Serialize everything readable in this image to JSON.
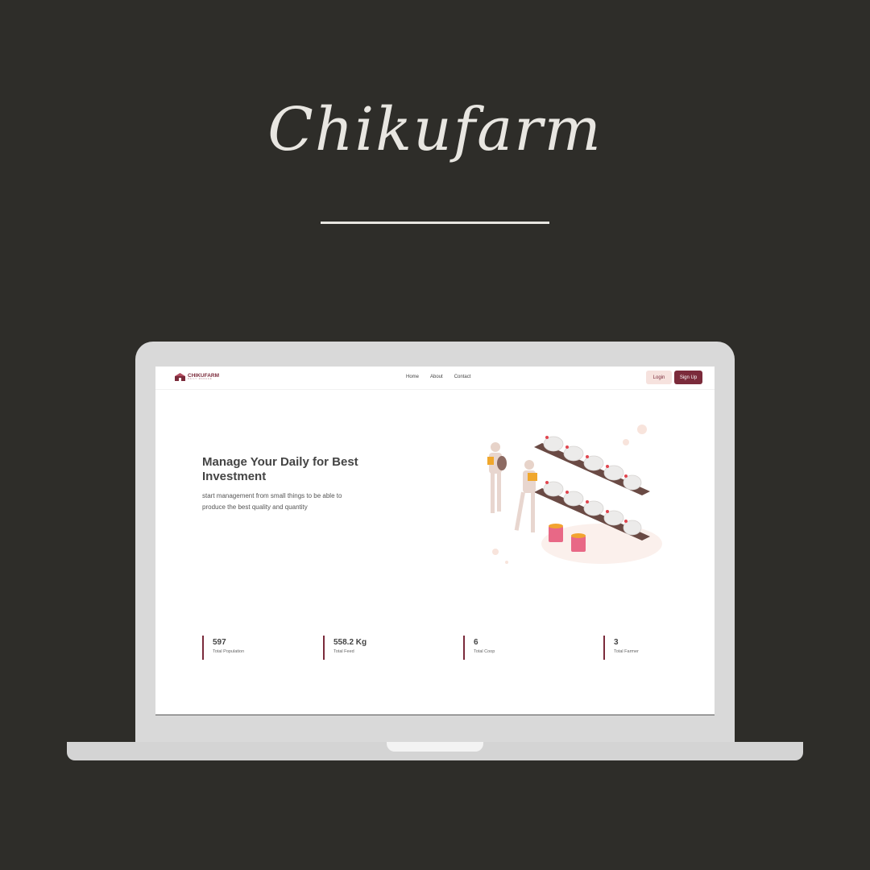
{
  "brand": {
    "title": "Chikufarm"
  },
  "app": {
    "logo": {
      "name": "CHIKUFARM",
      "tagline": "DAILY MANAGE"
    },
    "nav": {
      "links": [
        "Home",
        "About",
        "Contact"
      ]
    },
    "buttons": {
      "login": "Login",
      "signup": "Sign Up"
    },
    "hero": {
      "heading": "Manage Your Daily for Best Investment",
      "subtitle": "start management from small things to be able to produce the best quality and quantity"
    },
    "stats": [
      {
        "value": "597",
        "label": "Total Population"
      },
      {
        "value": "558.2 Kg",
        "label": "Total Feed"
      },
      {
        "value": "6",
        "label": "Total Coop"
      },
      {
        "value": "3",
        "label": "Total Farmer"
      }
    ]
  },
  "colors": {
    "background": "#2e2d29",
    "accent": "#7b2b3b",
    "login_bg": "#f6e2de",
    "laptop": "#d9d9d9"
  },
  "icons": [
    "farm-logo-icon",
    "poultry-farm-illustration"
  ]
}
